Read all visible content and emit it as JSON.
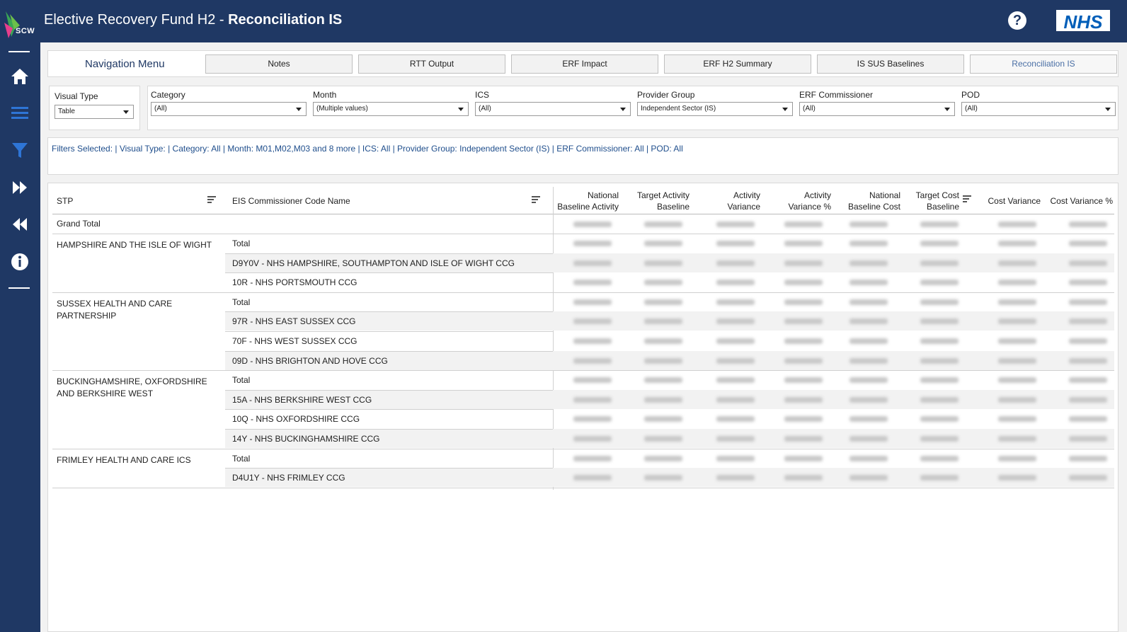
{
  "app": {
    "logo_text": "SCW",
    "title_prefix": "Elective Recovery Fund H2 - ",
    "title_bold": "Reconciliation IS",
    "help_label": "?",
    "nhs_logo": "NHS"
  },
  "sidebar": {
    "icons": [
      "home-icon",
      "menu-icon",
      "filter-icon",
      "fast-forward-icon",
      "rewind-icon",
      "info-icon"
    ]
  },
  "nav": {
    "label": "Navigation Menu",
    "buttons": [
      "Notes",
      "RTT Output",
      "ERF Impact",
      "ERF H2 Summary",
      "IS SUS Baselines",
      "Reconciliation IS"
    ]
  },
  "filters": {
    "visual_type": {
      "label": "Visual Type",
      "value": "Table"
    },
    "category": {
      "label": "Category",
      "value": "(All)"
    },
    "month": {
      "label": "Month",
      "value": "(Multiple values)"
    },
    "ics": {
      "label": "ICS",
      "value": "(All)"
    },
    "provider_group": {
      "label": "Provider Group",
      "value": "Independent Sector (IS)"
    },
    "erf_commissioner": {
      "label": "ERF Commissioner",
      "value": "(All)"
    },
    "pod": {
      "label": "POD",
      "value": "(All)"
    }
  },
  "filters_selected": "Filters Selected: | Visual Type: | Category: All | Month: M01,M02,M03 and 8 more | ICS: All | Provider Group: Independent Sector (IS) | ERF Commissioner: All | POD: All",
  "table": {
    "headers": {
      "stp": "STP",
      "commissioner": "EIS Commissioner Code Name",
      "nba_1": "National",
      "nba_2": "Baseline Activity",
      "tab_1": "Target Activity",
      "tab_2": "Baseline",
      "av_1": "Activity",
      "av_2": "Variance",
      "avp_1": "Activity",
      "avp_2": "Variance %",
      "nbc_1": "National",
      "nbc_2": "Baseline Cost",
      "tcb_1": "Target Cost",
      "tcb_2": "Baseline",
      "cv": "Cost Variance",
      "cvp": "Cost Variance %"
    },
    "grand_total": "Grand Total",
    "groups": [
      {
        "stp": "HAMPSHIRE AND THE ISLE OF WIGHT",
        "rows": [
          "Total",
          "D9Y0V - NHS HAMPSHIRE, SOUTHAMPTON AND ISLE OF WIGHT CCG",
          "10R - NHS PORTSMOUTH CCG"
        ]
      },
      {
        "stp": "SUSSEX HEALTH AND CARE PARTNERSHIP",
        "rows": [
          "Total",
          "97R - NHS EAST SUSSEX CCG",
          "70F - NHS WEST SUSSEX CCG",
          "09D - NHS BRIGHTON AND HOVE CCG"
        ]
      },
      {
        "stp": "BUCKINGHAMSHIRE, OXFORDSHIRE AND BERKSHIRE WEST",
        "rows": [
          "Total",
          "15A - NHS BERKSHIRE WEST CCG",
          "10Q - NHS OXFORDSHIRE CCG",
          "14Y - NHS BUCKINGHAMSHIRE CCG"
        ]
      },
      {
        "stp": "FRIMLEY HEALTH AND CARE ICS",
        "rows": [
          "Total",
          "D4U1Y - NHS FRIMLEY CCG"
        ]
      }
    ]
  }
}
